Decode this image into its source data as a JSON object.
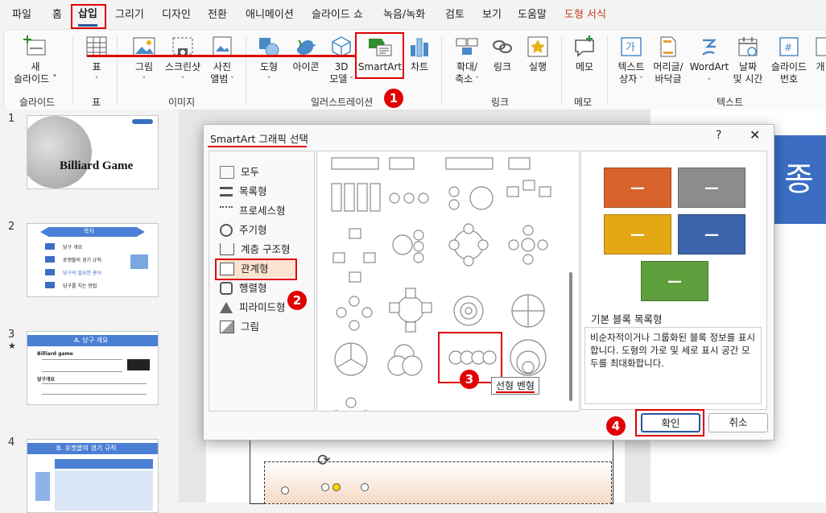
{
  "tabs": [
    "파일",
    "홈",
    "삽입",
    "그리기",
    "디자인",
    "전환",
    "애니메이션",
    "슬라이드 쇼",
    "녹음/녹화",
    "검토",
    "보기",
    "도움말",
    "도형 서식"
  ],
  "ribbon": {
    "new_slide": "새\n슬라이드 ˅",
    "table": "표",
    "picture": "그림",
    "screenshot": "스크린샷",
    "photo_album": "사진\n앨범",
    "shapes": "도형",
    "icons": "아이콘",
    "model3d": "3D\n모델",
    "smartart": "SmartArt",
    "chart": "차트",
    "zoom": "확대/\n축소",
    "link": "링크",
    "action": "실행",
    "comment": "메모",
    "textbox": "텍스트\n상자",
    "header_footer": "머리글/\n바닥글",
    "wordart": "WordArt",
    "date_time": "날짜\n및 시간",
    "slide_number": "슬라이드\n번호",
    "more": "개",
    "groups": {
      "slides": "슬라이드",
      "tables": "표",
      "images": "이미지",
      "illustrations": "일러스트레이션",
      "links": "링크",
      "comments": "메모",
      "text": "텍스트"
    }
  },
  "slides": [
    {
      "num": "1",
      "title": "Billiard Game"
    },
    {
      "num": "2",
      "title": "목차",
      "items": [
        "당구 개요",
        "포켓볼의 경기 규칙",
        "당구의 필요한 용어",
        "당구를 치는 방법"
      ]
    },
    {
      "num": "3",
      "title": "A. 당구 개요",
      "bullets": [
        "Billiard game",
        "당구개요"
      ]
    },
    {
      "num": "4",
      "title": "B. 포켓볼의 경기 규칙"
    }
  ],
  "editor": {
    "title_fragment": "종"
  },
  "dialog": {
    "title": "SmartArt 그래픽 선택",
    "help": "?",
    "close": "✕",
    "categories": [
      "모두",
      "목록형",
      "프로세스형",
      "주기형",
      "계층 구조형",
      "관계형",
      "행렬형",
      "피라미드형",
      "그림"
    ],
    "selected_category": "관계형",
    "tooltip": "선형 벤형",
    "preview_title": "기본 블록 목록형",
    "preview_desc": "비순차적이거나 그룹화된 블록 정보를 표시합니다. 도형의 가로 및 세로 표시 공간 모두를 최대화합니다.",
    "ok": "확인",
    "cancel": "취소",
    "block_colors": [
      "#d9622b",
      "#8c8c8c",
      "#e3a814",
      "#3e63ad",
      "#5f9e3d"
    ]
  },
  "badges": [
    "1",
    "2",
    "3",
    "4"
  ],
  "accent": "#e00000"
}
